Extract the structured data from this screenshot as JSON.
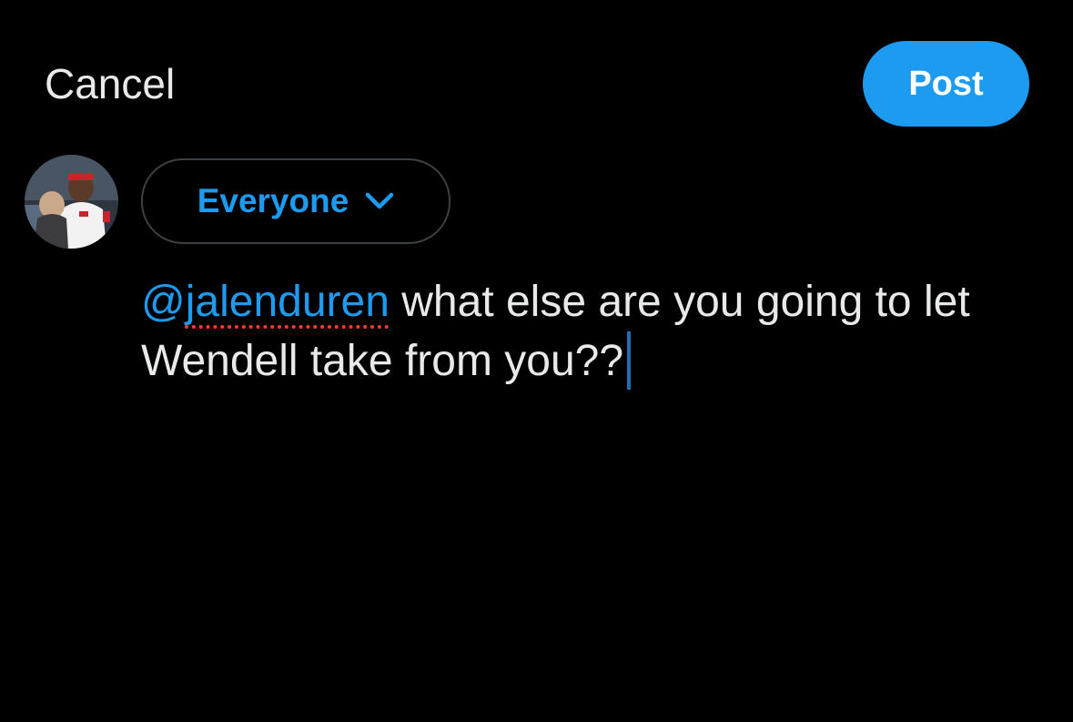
{
  "header": {
    "cancel_label": "Cancel",
    "post_label": "Post"
  },
  "audience": {
    "label": "Everyone"
  },
  "composer": {
    "mention_at": "@",
    "mention_name": "jalenduren",
    "text": " what else are you going to let Wendell take from you??"
  },
  "icons": {
    "audience_dropdown": "chevron-down-icon",
    "avatar": "user-avatar"
  },
  "colors": {
    "background": "#000000",
    "accent": "#1d9bf0",
    "text": "#e7e9ea",
    "spellcheck": "#ff3b30"
  }
}
